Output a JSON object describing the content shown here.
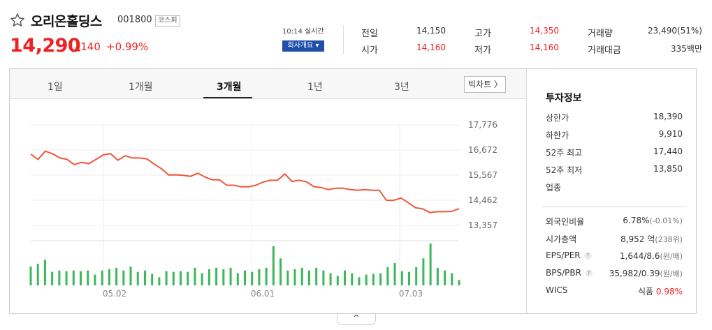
{
  "stock": {
    "name": "오리온홀딩스",
    "code": "001800",
    "market": "코스피",
    "price": "14,290",
    "change": "140",
    "change_pct": "+0.99%",
    "realtime": "10:14 실시간",
    "company_btn": "회사개요 ▾"
  },
  "quote": {
    "prev_label": "전일",
    "prev": "14,150",
    "open_label": "시가",
    "open": "14,160",
    "high_label": "고가",
    "high": "14,350",
    "low_label": "저가",
    "low": "14,160",
    "volume_label": "거래량",
    "volume": "23,490(51%)",
    "amount_label": "거래대금",
    "amount": "335백만"
  },
  "tabs": [
    "1일",
    "1개월",
    "3개월",
    "1년",
    "3년"
  ],
  "active_tab": "3개월",
  "big_chart_btn": "빅차트 〉",
  "invest": {
    "title": "투자정보",
    "upper_label": "상한가",
    "upper": "18,390",
    "lower_label": "하한가",
    "lower": "9,910",
    "high52_label": "52주 최고",
    "high52": "17,440",
    "low52_label": "52주 최저",
    "low52": "13,850",
    "sector_label": "업종",
    "foreign_label": "외국인비율",
    "foreign": "6.78%",
    "foreign_chg": "(-0.01%)",
    "mcap_label": "시가총액",
    "mcap": "8,952 억",
    "mcap_rank": "(238위)",
    "eps_label": "EPS/PER",
    "eps": "1,644/8.6",
    "eps_unit": "(원/배)",
    "bps_label": "BPS/PBR",
    "bps": "35,982/0.39",
    "bps_unit": "(원/배)",
    "wics_label": "WICS",
    "wics": "식품",
    "wics_chg": "0.98%",
    "help_mark": "?"
  },
  "collapse_icon": "^",
  "chart_data": {
    "type": "line",
    "title": "",
    "xlabel": "",
    "ylabel": "",
    "y_ticks": [
      "17,776",
      "16,672",
      "15,567",
      "14,462",
      "13,357"
    ],
    "x_ticks": [
      "05.02",
      "06.01",
      "07.03"
    ],
    "ylim": [
      13357,
      17776
    ],
    "line_color": "#f0563a",
    "volume_color": "#3bb857",
    "price": [
      16490,
      16260,
      16620,
      16510,
      16320,
      16260,
      16030,
      16130,
      16070,
      16260,
      16460,
      16510,
      16220,
      16420,
      16320,
      16320,
      16280,
      16050,
      15850,
      15570,
      15580,
      15560,
      15510,
      15650,
      15480,
      15360,
      15360,
      15120,
      15120,
      15050,
      15050,
      15120,
      15260,
      15340,
      15340,
      15620,
      15290,
      15340,
      15270,
      15060,
      15020,
      14930,
      14990,
      14990,
      14930,
      14900,
      14930,
      14900,
      14900,
      14460,
      14460,
      14560,
      14350,
      14130,
      14080,
      13920,
      13960,
      13960,
      13970,
      14090
    ],
    "volume": [
      28,
      32,
      38,
      20,
      22,
      21,
      22,
      21,
      22,
      16,
      22,
      24,
      26,
      22,
      28,
      20,
      22,
      17,
      12,
      21,
      20,
      21,
      20,
      26,
      18,
      24,
      26,
      24,
      26,
      18,
      22,
      20,
      24,
      26,
      58,
      40,
      22,
      24,
      26,
      22,
      26,
      22,
      18,
      14,
      22,
      18,
      12,
      16,
      17,
      18,
      27,
      33,
      21,
      20,
      27,
      40,
      62,
      26,
      22,
      18,
      8
    ]
  }
}
